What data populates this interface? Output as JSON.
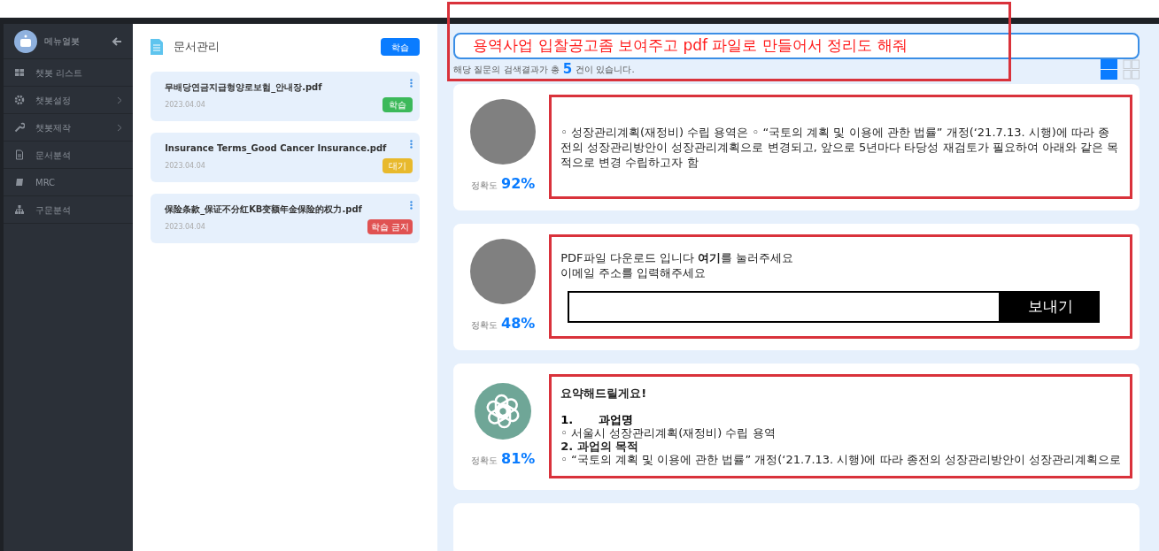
{
  "sidebar": {
    "title": "메뉴얼봇",
    "items": [
      {
        "label": "챗봇 리스트",
        "has_submenu": false
      },
      {
        "label": "챗봇설정",
        "has_submenu": true
      },
      {
        "label": "챗봇제작",
        "has_submenu": true
      },
      {
        "label": "문서분석",
        "has_submenu": false
      },
      {
        "label": "MRC",
        "has_submenu": false
      },
      {
        "label": "구문분석",
        "has_submenu": false
      }
    ]
  },
  "documents": {
    "title": "문서관리",
    "action": "학습",
    "items": [
      {
        "name": "무배당연금지급형양로보험_안내장.pdf",
        "date": "2023.04.04",
        "status": "학습",
        "color": "#3cb95a"
      },
      {
        "name": "Insurance Terms_Good Cancer Insurance.pdf",
        "date": "2023.04.04",
        "status": "대기",
        "color": "#e8b92c"
      },
      {
        "name": "保险条款_保证不分红KB变额年金保险的权力.pdf",
        "date": "2023.04.04",
        "status": "학습 금지",
        "color": "#e05252"
      }
    ]
  },
  "query": {
    "value": "용역사업 입찰공고좀 보여주고 pdf 파일로 만들어서 정리도 해줘"
  },
  "result_count": {
    "before": "해당 질문의 검색결과가 총",
    "count": "5",
    "after": "건이 있습니다."
  },
  "view_modes": [
    {
      "kind": "list",
      "selected": true
    },
    {
      "kind": "grid",
      "selected": false
    }
  ],
  "results": [
    {
      "avatar": {
        "kind": "circle"
      },
      "accuracy_label": "정확도",
      "accuracy": "92%",
      "kind": "text",
      "text": "◦ 성장관리계획(재정비) 수립 용역은 ◦ “국토의 계획 및 이용에 관한 법률” 개정(‘21.7.13. 시행)에 따라 종전의 성장관리방안이 성장관리계획으로 변경되고, 앞으로 5년마다 타당성 재검토가 필요하여 아래와 같은 목적으로 변경 수립하고자 함"
    },
    {
      "avatar": {
        "kind": "circle"
      },
      "accuracy_label": "정확도",
      "accuracy": "48%",
      "kind": "email",
      "lines": [
        "PDF파일 다운로드 입니다 **여기**를 눌러주세요",
        "이메일 주소를 입력해주세요"
      ],
      "button": "보내기"
    },
    {
      "avatar": {
        "kind": "logo"
      },
      "accuracy_label": "정확도",
      "accuracy": "81%",
      "kind": "summary",
      "lines": [
        {
          "text": "요약해드릴게요!",
          "bold": true,
          "gap_after": true
        },
        {
          "number": "1.",
          "text": "과업명",
          "bold": true,
          "gap_after": false
        },
        {
          "text": "◦ 서울시 성장관리계획(재정비) 수립 용역",
          "bold": false,
          "gap_after": false
        },
        {
          "text": "2. 과업의 목적",
          "bold": true,
          "gap_after": false
        },
        {
          "text": "◦ “국토의 계획 및 이용에 관한 법률” 개정(‘21.7.13. 시행)에 따라 종전의 성장관리방안이 성장관리계획으로",
          "bold": false,
          "gap_after": false
        }
      ]
    }
  ]
}
